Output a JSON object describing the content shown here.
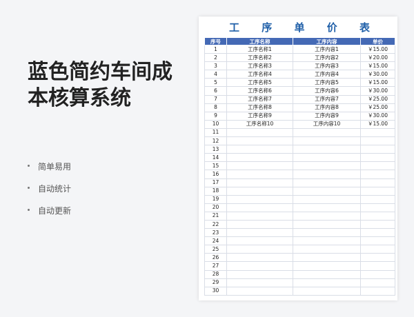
{
  "page_title_lines": [
    "蓝色简约车间成",
    "本核算系统"
  ],
  "features": [
    "简单易用",
    "自动统计",
    "自动更新"
  ],
  "sheet": {
    "title_chars": [
      "工",
      "序",
      "单",
      "价",
      "表"
    ],
    "headers": [
      "序号",
      "工序名称",
      "工序内容",
      "单价"
    ],
    "rows": [
      [
        "1",
        "工序名称1",
        "工序内容1",
        "￥15.00"
      ],
      [
        "2",
        "工序名称2",
        "工序内容2",
        "￥20.00"
      ],
      [
        "3",
        "工序名称3",
        "工序内容3",
        "￥15.00"
      ],
      [
        "4",
        "工序名称4",
        "工序内容4",
        "￥30.00"
      ],
      [
        "5",
        "工序名称5",
        "工序内容5",
        "￥15.00"
      ],
      [
        "6",
        "工序名称6",
        "工序内容6",
        "￥30.00"
      ],
      [
        "7",
        "工序名称7",
        "工序内容7",
        "￥25.00"
      ],
      [
        "8",
        "工序名称8",
        "工序内容8",
        "￥25.00"
      ],
      [
        "9",
        "工序名称9",
        "工序内容9",
        "￥30.00"
      ],
      [
        "10",
        "工序名称10",
        "工序内容10",
        "￥15.00"
      ],
      [
        "11",
        "",
        "",
        ""
      ],
      [
        "12",
        "",
        "",
        ""
      ],
      [
        "13",
        "",
        "",
        ""
      ],
      [
        "14",
        "",
        "",
        ""
      ],
      [
        "15",
        "",
        "",
        ""
      ],
      [
        "16",
        "",
        "",
        ""
      ],
      [
        "17",
        "",
        "",
        ""
      ],
      [
        "18",
        "",
        "",
        ""
      ],
      [
        "19",
        "",
        "",
        ""
      ],
      [
        "20",
        "",
        "",
        ""
      ],
      [
        "21",
        "",
        "",
        ""
      ],
      [
        "22",
        "",
        "",
        ""
      ],
      [
        "23",
        "",
        "",
        ""
      ],
      [
        "24",
        "",
        "",
        ""
      ],
      [
        "25",
        "",
        "",
        ""
      ],
      [
        "26",
        "",
        "",
        ""
      ],
      [
        "27",
        "",
        "",
        ""
      ],
      [
        "28",
        "",
        "",
        ""
      ],
      [
        "29",
        "",
        "",
        ""
      ],
      [
        "30",
        "",
        "",
        ""
      ]
    ]
  },
  "colors": {
    "header_blue": "#4469b5",
    "title_blue": "#1f5fa8"
  }
}
